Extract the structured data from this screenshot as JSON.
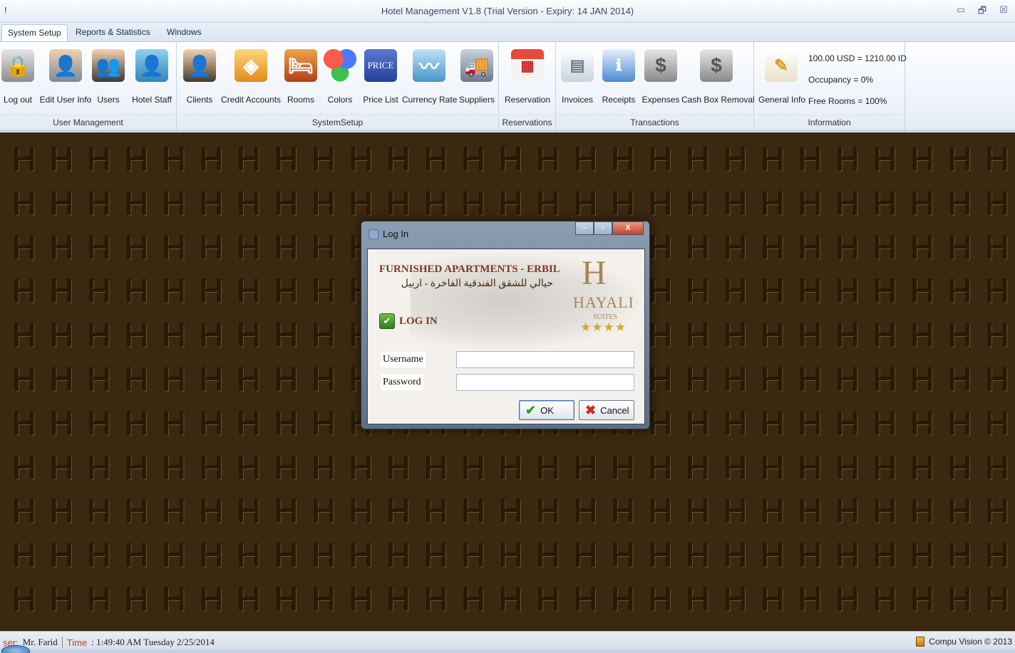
{
  "window": {
    "app_mark": "!",
    "title": "Hotel Management V1.8 (Trial Version - Expiry: 14 JAN 2014)",
    "controls": {
      "minimize": "▭",
      "restore": "🗗",
      "close": "☒"
    }
  },
  "tabs": [
    {
      "label": "System Setup",
      "active": true
    },
    {
      "label": "Reports & Statistics",
      "active": false
    },
    {
      "label": "Windows",
      "active": false
    }
  ],
  "ribbon": {
    "user_management": {
      "label": "User Management",
      "buttons": [
        {
          "label": "Log out",
          "icon": "lock-icon"
        },
        {
          "label": "Edit User Info",
          "icon": "user-edit-icon"
        },
        {
          "label": "Users",
          "icon": "users-icon"
        },
        {
          "label": "Hotel Staff",
          "icon": "staff-folder-icon"
        }
      ]
    },
    "system_setup": {
      "label": "SystemSetup",
      "buttons": [
        {
          "label": "Clients",
          "icon": "client-icon"
        },
        {
          "label": "Credit Accounts",
          "icon": "credit-accounts-icon"
        },
        {
          "label": "Rooms",
          "icon": "rooms-icon"
        },
        {
          "label": "Colors",
          "icon": "colors-icon"
        },
        {
          "label": "Price List",
          "icon": "price-list-icon",
          "icon_text": "PRICE"
        },
        {
          "label": "Currency Rate",
          "icon": "currency-rate-icon"
        },
        {
          "label": "Suppliers",
          "icon": "suppliers-truck-icon"
        }
      ]
    },
    "reservations": {
      "label": "Reservations",
      "buttons": [
        {
          "label": "Reservation",
          "icon": "calendar-icon"
        }
      ]
    },
    "transactions": {
      "label": "Transactions",
      "buttons": [
        {
          "label": "Invoices",
          "icon": "invoice-icon"
        },
        {
          "label": "Receipts",
          "icon": "receipt-icon"
        },
        {
          "label": "Expenses",
          "icon": "dollar-icon"
        },
        {
          "label": "Cash Box Removal",
          "icon": "cash-box-icon"
        }
      ]
    },
    "information": {
      "label": "Information",
      "general_info_label": "General Info",
      "rate": "100.00 USD = 1210.00 ID",
      "occupancy": "Occupancy = 0%",
      "free_rooms": "Free Rooms = 100%"
    }
  },
  "workspace": {
    "pattern_letter": "H"
  },
  "login_dialog": {
    "title": "Log In",
    "controls": {
      "minimize": "‒",
      "maximize": "▫",
      "close": "X"
    },
    "hotel_name": "FURNISHED APARTMENTS - ERBIL",
    "hotel_name_arabic": "حيالي للشقق الفندقية الفاخرة - اربيل",
    "brand_letter": "H",
    "brand_name": "HAYALI",
    "brand_sub": "SUITES",
    "brand_stars": "★★★★",
    "section_label": "LOG IN",
    "username_label": "Username",
    "username_value": "",
    "password_label": "Password",
    "password_value": "",
    "ok_label": "OK",
    "cancel_label": "Cancel"
  },
  "status": {
    "user_key": "ser:",
    "user_value": "Mr. Farid",
    "time_key": "Time",
    "time_value": ": 1:49:40 AM Tuesday 2/25/2014",
    "vendor": "Compu Vision © 2013"
  },
  "colors": {
    "workspace_bg": "#3a2810",
    "brand_gold": "#a88453",
    "heading_brown": "#7a3a1a"
  }
}
